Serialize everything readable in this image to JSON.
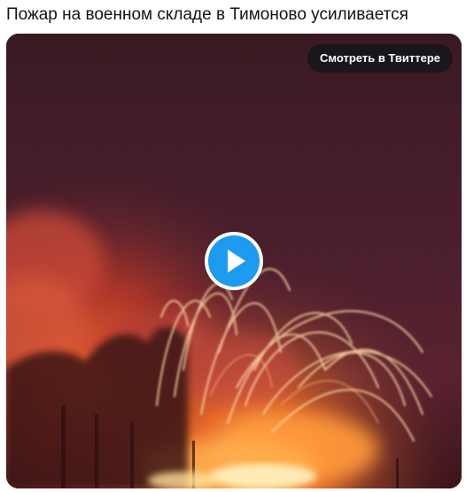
{
  "tweet": {
    "text": "Пожар на военном складе в Тимоново усиливается"
  },
  "media": {
    "type": "video",
    "watch_on_twitter_label": "Смотреть в Твиттере",
    "play_icon": "play-icon",
    "accent_color": "#1d9bf0"
  }
}
